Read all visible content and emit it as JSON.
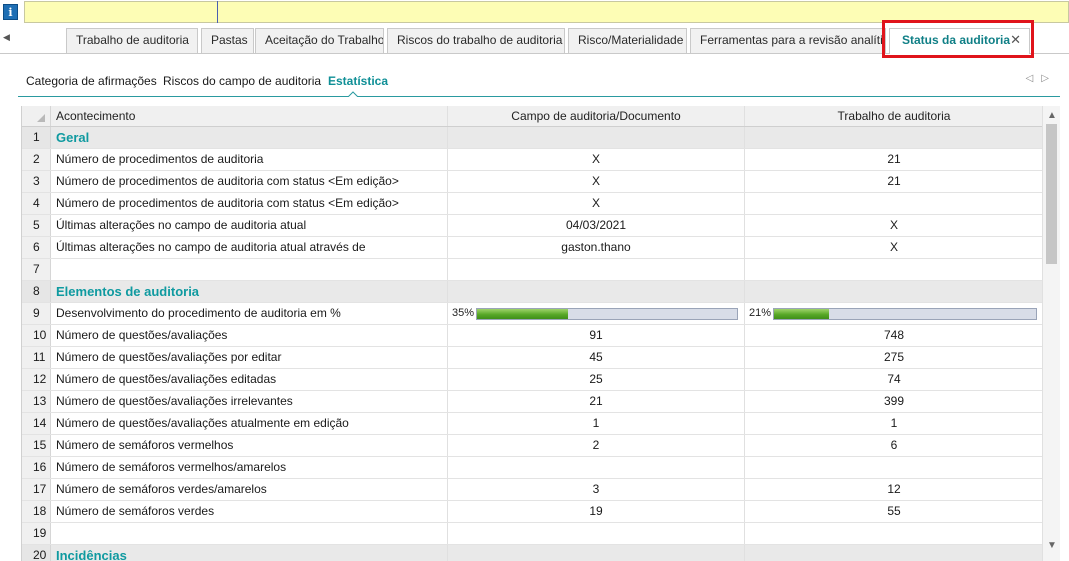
{
  "topbar": {
    "info_icon": "i"
  },
  "doc_tabs": [
    {
      "label": "Trabalho de auditoria"
    },
    {
      "label": "Pastas"
    },
    {
      "label": "Aceitação do Trabalho"
    },
    {
      "label": "Riscos do trabalho de auditoria"
    },
    {
      "label": "Risco/Materialidade"
    },
    {
      "label": "Ferramentas para a revisão analítica"
    },
    {
      "label": "Status da auditoria",
      "close": "✕"
    }
  ],
  "sub_tabs": [
    {
      "label": "Categoria de afirmações"
    },
    {
      "label": "Riscos do campo de auditoria"
    },
    {
      "label": "Estatística"
    }
  ],
  "grid": {
    "headers": {
      "event": "Acontecimento",
      "campo": "Campo de auditoria/Documento",
      "trabalho": "Trabalho de auditoria"
    },
    "rows": [
      {
        "num": "1",
        "event": "Geral",
        "campo": "",
        "trabalho": ""
      },
      {
        "num": "2",
        "event": "Número de procedimentos de auditoria",
        "campo": "X",
        "trabalho": "21"
      },
      {
        "num": "3",
        "event": "Número de procedimentos de auditoria com status <Em edição>",
        "campo": "X",
        "trabalho": "21"
      },
      {
        "num": "4",
        "event": "Número de procedimentos de auditoria com status <Em edição>",
        "campo": "X",
        "trabalho": ""
      },
      {
        "num": "5",
        "event": "Últimas alterações no campo de auditoria atual",
        "campo": "04/03/2021",
        "trabalho": "X"
      },
      {
        "num": "6",
        "event": "Últimas alterações no campo de auditoria atual através de",
        "campo": "gaston.thano",
        "trabalho": "X"
      },
      {
        "num": "7",
        "event": "",
        "campo": "",
        "trabalho": ""
      },
      {
        "num": "8",
        "event": "Elementos de auditoria",
        "campo": "",
        "trabalho": ""
      },
      {
        "num": "9",
        "event": "Desenvolvimento do procedimento de auditoria em %",
        "campo_progress": {
          "label": "35%",
          "value": 35
        },
        "trabalho_progress": {
          "label": "21%",
          "value": 21
        }
      },
      {
        "num": "10",
        "event": "Número de questões/avaliações",
        "campo": "91",
        "trabalho": "748"
      },
      {
        "num": "11",
        "event": "Número de questões/avaliações por editar",
        "campo": "45",
        "trabalho": "275"
      },
      {
        "num": "12",
        "event": "Número de questões/avaliações editadas",
        "campo": "25",
        "trabalho": "74"
      },
      {
        "num": "13",
        "event": "Número de questões/avaliações irrelevantes",
        "campo": "21",
        "trabalho": "399"
      },
      {
        "num": "14",
        "event": "Número de questões/avaliações atualmente em edição",
        "campo": "1",
        "trabalho": "1"
      },
      {
        "num": "15",
        "event": "Número de semáforos vermelhos",
        "campo": "2",
        "trabalho": "6"
      },
      {
        "num": "16",
        "event": "Número de semáforos vermelhos/amarelos",
        "campo": "",
        "trabalho": ""
      },
      {
        "num": "17",
        "event": "Número de semáforos verdes/amarelos",
        "campo": "3",
        "trabalho": "12"
      },
      {
        "num": "18",
        "event": "Número de semáforos verdes",
        "campo": "19",
        "trabalho": "55"
      },
      {
        "num": "19",
        "event": "",
        "campo": "",
        "trabalho": ""
      },
      {
        "num": "20",
        "event": "Incidências",
        "campo": "",
        "trabalho": ""
      }
    ]
  },
  "colors": {
    "accent": "#0f8f96",
    "highlight": "#e0141b",
    "yellow": "#fdfdb5"
  }
}
